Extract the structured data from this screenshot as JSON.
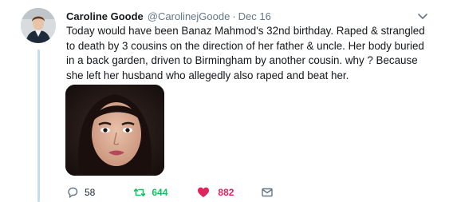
{
  "tweet": {
    "author_name": "Caroline Goode",
    "handle": "@CarolinejGoode",
    "separator": "·",
    "date": "Dec 16",
    "text": "Today would have been Banaz Mahmod's 32nd birthday.  Raped & strangled to death by 3 cousins on the direction of her father & uncle. Her body buried in a back garden, driven to Birmingham by another cousin. why ? Because she left her husband who allegedly also raped and beat her.",
    "media_icon": "photo-portrait"
  },
  "actions": {
    "reply_count": "58",
    "retweet_count": "644",
    "like_count": "882",
    "reply_icon": "reply-icon",
    "retweet_icon": "retweet-icon",
    "like_icon": "heart-icon",
    "dm_icon": "envelope-icon"
  },
  "colors": {
    "thread_line": "#c4dcec",
    "secondary_text": "#657786",
    "retweet_green": "#17bf63",
    "like_red": "#e0245e"
  }
}
